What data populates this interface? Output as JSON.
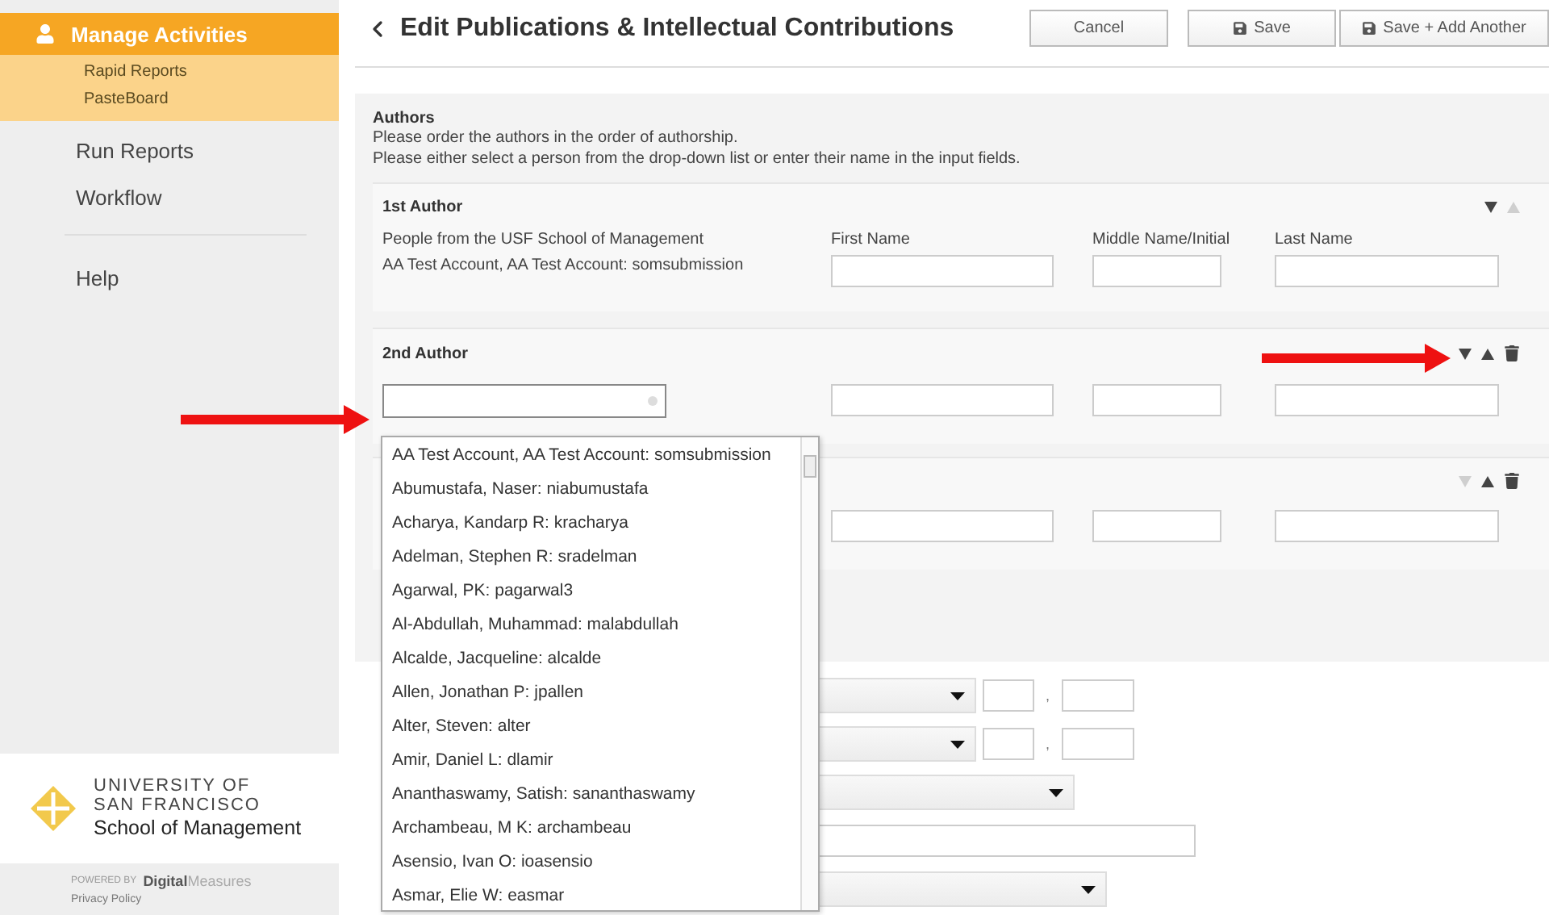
{
  "sidebar": {
    "menu": [
      {
        "label": "Manage Activities",
        "selected": true,
        "children": [
          {
            "label": "Rapid Reports"
          },
          {
            "label": "PasteBoard"
          }
        ]
      },
      {
        "label": "Run Reports",
        "selected": false
      },
      {
        "label": "Workflow",
        "selected": false
      },
      {
        "label": "Help",
        "selected": false
      }
    ],
    "logo": {
      "lines": [
        "UNIVERSITY OF",
        "SAN FRANCISCO"
      ],
      "school": "School of Management"
    },
    "powered_by": {
      "prefix": "POWERED BY",
      "brand": "**Digital**Measures"
    },
    "privacy_link": "Privacy Policy"
  },
  "header": {
    "title": "Edit Publications & Intellectual Contributions",
    "buttons": [
      {
        "label": "Cancel",
        "kind": "plain"
      },
      {
        "label": "Save",
        "kind": "save"
      },
      {
        "label": "Save + Add Another",
        "kind": "save-add"
      }
    ]
  },
  "authors": {
    "heading": "Authors",
    "instructions": [
      "Please order the authors in the order of authorship.",
      "Please either select a person from the drop-down list or enter their name in the input fields."
    ],
    "entries": [
      {
        "heading": "1st Author",
        "can_move_down": true,
        "can_move_up": false,
        "deletable": false,
        "people_label": "People from the USF School of Management",
        "selected_person": "AA Test Account, AA Test Account: somsubmission",
        "field_labels": [
          "First Name",
          "Middle Name/Initial",
          "Last Name"
        ]
      },
      {
        "heading": "2nd Author",
        "can_move_down": true,
        "can_move_up": true,
        "deletable": true,
        "picker_open": true
      },
      {
        "can_move_down": false,
        "can_move_up": true,
        "deletable": true
      }
    ]
  },
  "person_dropdown": {
    "options": [
      "AA Test Account, AA Test Account: somsubmission",
      "Abumustafa, Naser: niabumustafa",
      "Acharya, Kandarp R: kracharya",
      "Adelman, Stephen R: sradelman",
      "Agarwal, PK: pagarwal3",
      "Al-Abdullah, Muhammad: malabdullah",
      "Alcalde, Jacqueline: alcalde",
      "Allen, Jonathan P: jpallen",
      "Alter, Steven: alter",
      "Amir, Daniel L: dlamir",
      "Ananthaswamy, Satish: sananthaswamy",
      "Archambeau, M K: archambeau",
      "Asensio, Ivan O: ioasensio",
      "Asmar, Elie W: easmar"
    ]
  },
  "lower_form_rows": [
    {
      "kind": "select-pair",
      "separator": ","
    },
    {
      "kind": "select-pair",
      "separator": ","
    },
    {
      "kind": "select"
    },
    {
      "kind": "input"
    },
    {
      "kind": "select-short"
    }
  ],
  "annotations": [
    {
      "kind": "arrow",
      "color": "#ee1111"
    },
    {
      "kind": "arrow",
      "color": "#ee1111"
    }
  ]
}
